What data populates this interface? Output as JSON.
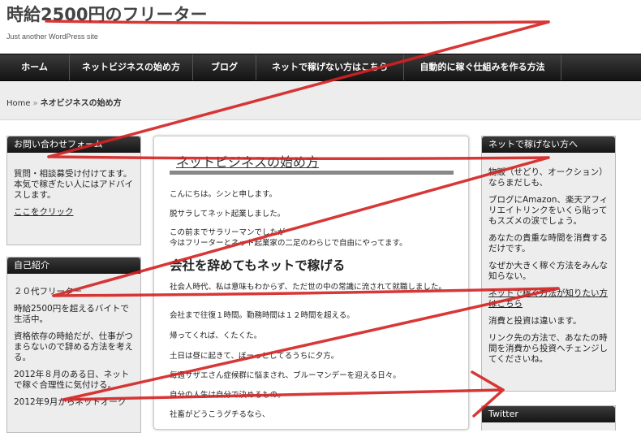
{
  "site": {
    "title": "時給2500円のフリーター",
    "tagline": "Just another WordPress site"
  },
  "nav": {
    "items": [
      "ホーム",
      "ネットビジネスの始め方",
      "ブログ",
      "ネットで稼げない方はこちら",
      "自動的に稼ぐ仕組みを作る方法"
    ]
  },
  "breadcrumb": {
    "home": "Home",
    "separator": "»",
    "current": "ネオビジネスの始め方"
  },
  "left_sidebar": {
    "contact": {
      "title": "お問い合わせフォーム",
      "line1": "質問・相談募受け付けてます。",
      "line2": "本気で稼ぎたい人にはアドバイスします。",
      "link": "ここをクリック"
    },
    "profile": {
      "title": "自己紹介",
      "p1": "２０代フリーター",
      "p2": "時給2500円を超えるバイトで生活中。",
      "p3": "資格依存の時給だが、仕事がつまらないので辞める方法を考える。",
      "p4": "2012年８月のある日、ネットで稼ぐ合理性に気付ける。",
      "p5": "2012年9月からネットオーク"
    }
  },
  "main": {
    "title": "ネットビジネスの始め方",
    "lines": [
      "こんにちは。シンと申します。",
      "脱サラしてネット起業しました。",
      "この前までサラリーマンでしたが",
      "今はフリーターとネット起業家の二足のわらじで自由にやってます。"
    ],
    "heading": "会社を辞めてもネットで稼げる",
    "lines2": [
      "社会人時代、私は意味もわからず、ただ世の中の常識に流されて就職しました。",
      "会社まで往復１時間。勤務時間は１２時間を超える。",
      "帰ってくれば、くたくた。",
      "土日は昼に起きて、ぼーっとしてるうちに夕方。",
      "毎週サザエさん症候群に悩まされ、ブルーマンデーを迎える日々。",
      "自分の人生は自分で決めるもの。",
      "社畜がどうこうグチるなら、"
    ]
  },
  "right_sidebar": {
    "title": "ネットで稼げない方へ",
    "p1": "物販（せどり、オークション）ならまだしも、",
    "p2": "ブログにAmazon、楽天アフィリエイトリンクをいくら貼ってもスズメの涙でしょう。",
    "p3": "あなたの貴重な時間を消費するだけです。",
    "p4": "なぜか大きく稼ぐ方法をみんな知らない。",
    "link": "ネットで稼ぐ方法が知りたい方はこちら",
    "p5": "消費と投資は違います。",
    "p6": "リンク先の方法で、あなたの時間を消費から投資へチェンジしてくださいね。",
    "twitter_title": "Twitter"
  },
  "colors": {
    "nav_bg": "#1e1e1e",
    "annotation_red": "#d42222",
    "widget_bg": "#ededed"
  }
}
